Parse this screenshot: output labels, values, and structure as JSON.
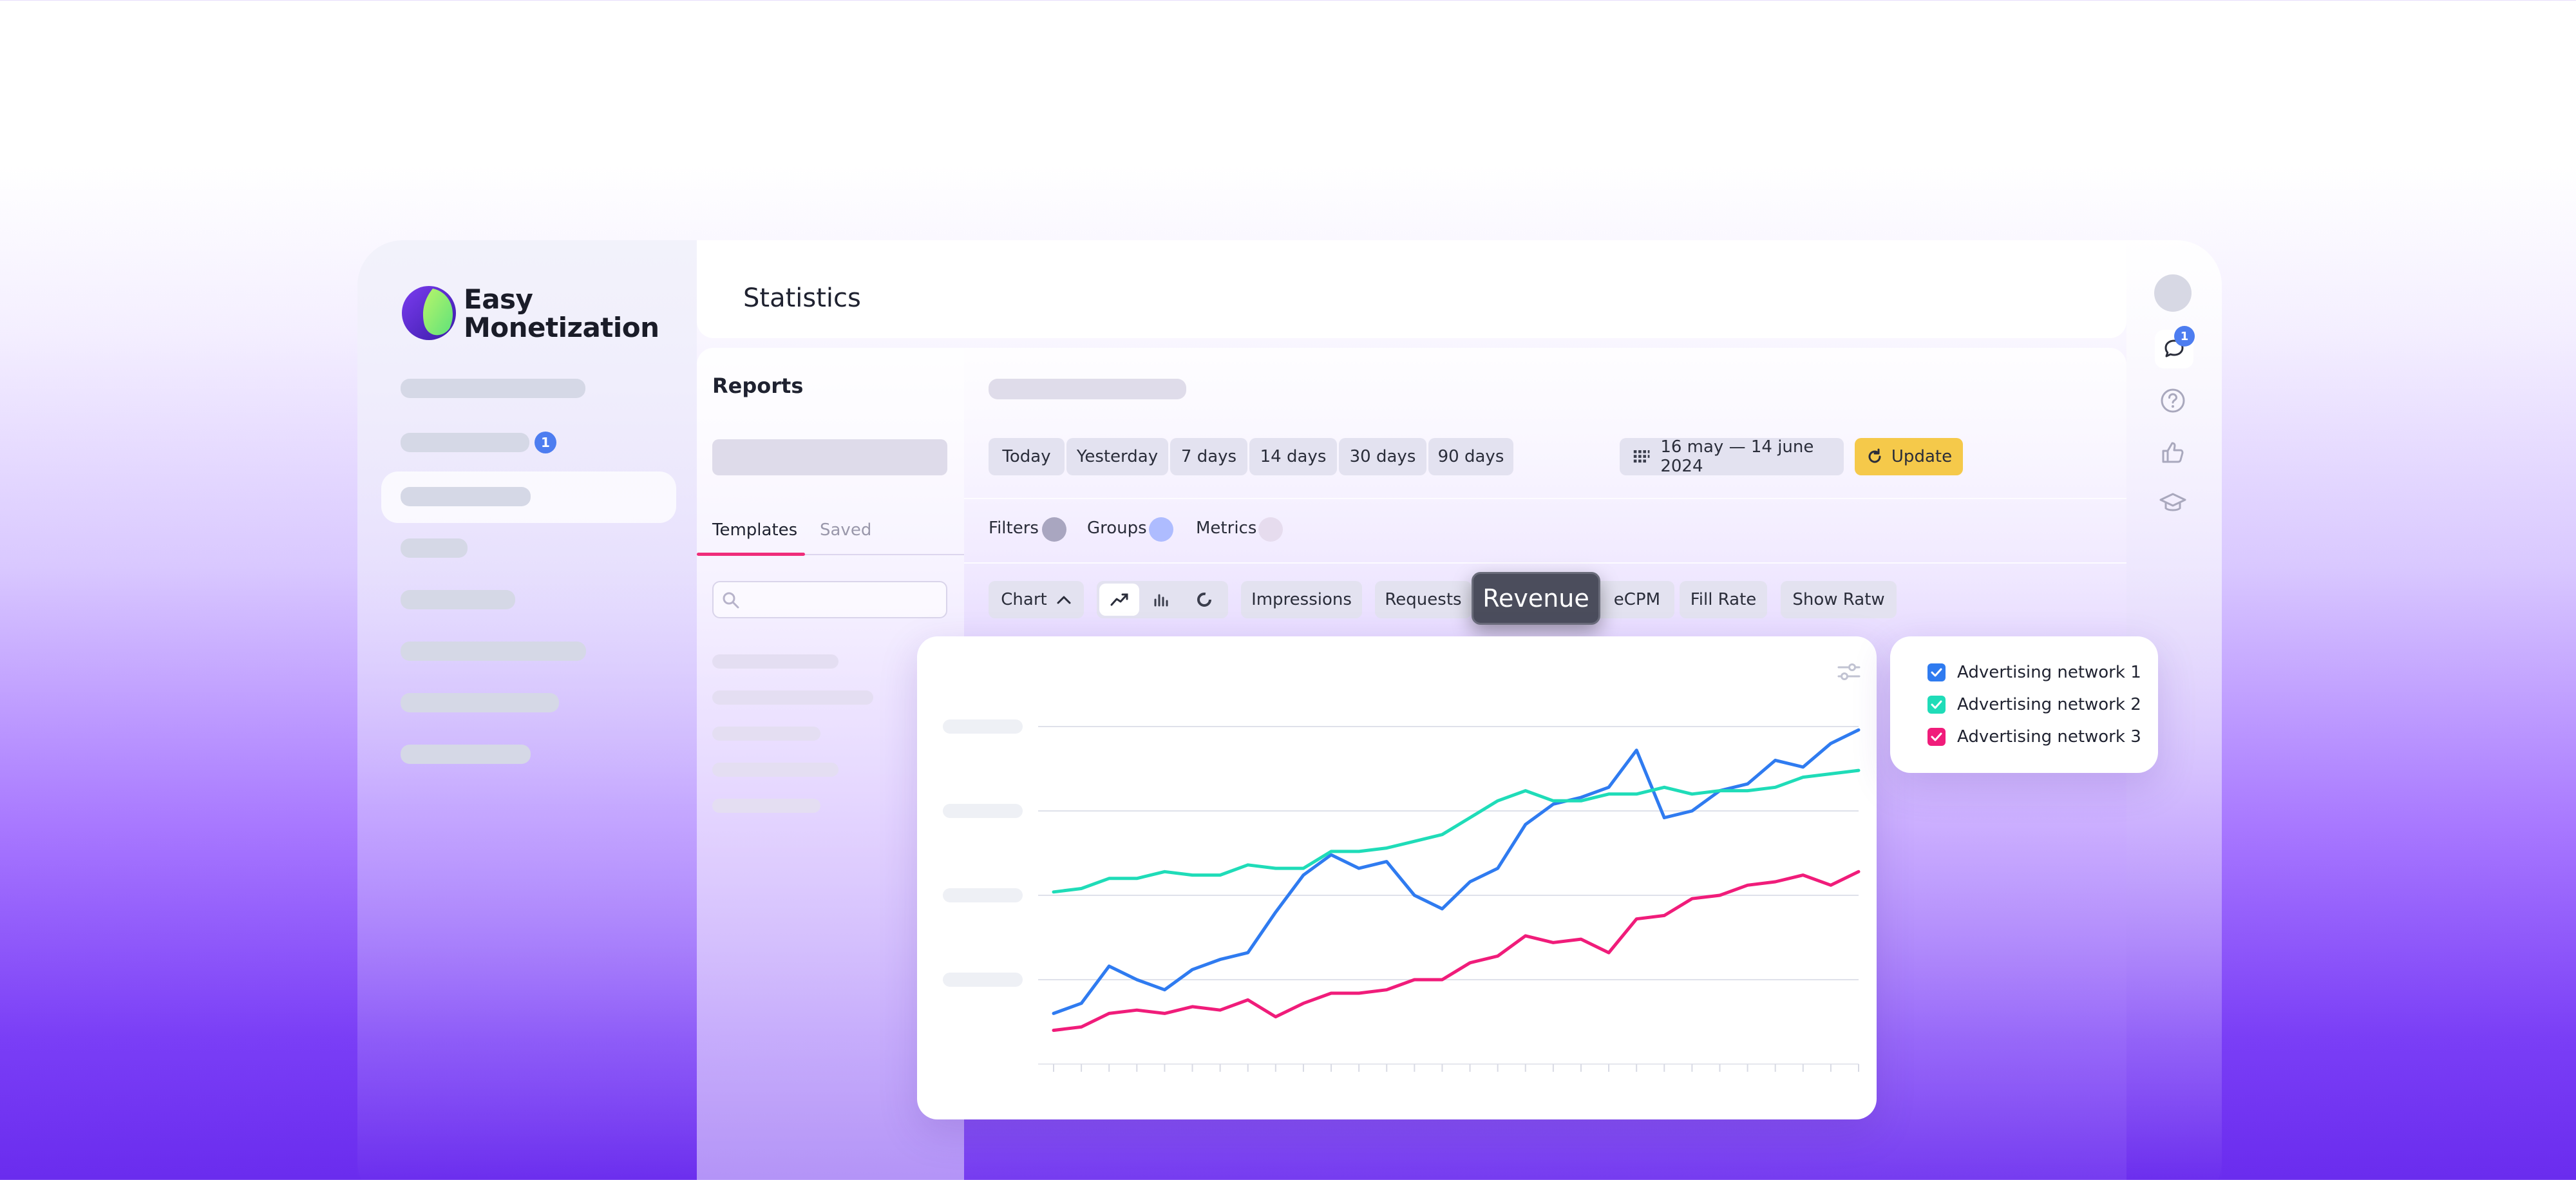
{
  "app": {
    "name_line1": "Easy",
    "name_line2": "Monetization"
  },
  "sidebar": {
    "badge_count": "1"
  },
  "header": {
    "title": "Statistics"
  },
  "reports": {
    "title": "Reports",
    "tabs": [
      {
        "label": "Templates",
        "active": true
      },
      {
        "label": "Saved",
        "active": false
      }
    ]
  },
  "periods": [
    "Today",
    "Yesterday",
    "7 days",
    "14 days",
    "30 days",
    "90 days"
  ],
  "date_range": "16 may — 14 june 2024",
  "update_label": "Update",
  "filters": [
    {
      "label": "Filters",
      "color": "#a9a6c0"
    },
    {
      "label": "Groups",
      "color": "#aebcff"
    },
    {
      "label": "Metrics",
      "color": "#e6dcee"
    }
  ],
  "metrics": {
    "chart_label": "Chart",
    "items": [
      "Impressions",
      "Requests",
      "eCPM",
      "Fill Rate",
      "Show Ratw"
    ],
    "tooltip": "Revenue"
  },
  "right_rail": {
    "messages_badge": "1"
  },
  "icons": [
    "calendar-grid-icon",
    "refresh-icon",
    "chevron-up-icon",
    "line-chart-icon",
    "bar-chart-icon",
    "donut-chart-icon",
    "search-icon",
    "settings-sliders-icon",
    "chat-icon",
    "help-icon",
    "thumbs-up-icon",
    "graduation-cap-icon"
  ],
  "colors": {
    "network1": "#2f7bf0",
    "network2": "#1fdcb8",
    "network3": "#f01c7a",
    "accent_update": "#f5c94a"
  },
  "chart_data": {
    "type": "line",
    "title": "",
    "xlabel": "",
    "ylabel": "",
    "x": [
      1,
      2,
      3,
      4,
      5,
      6,
      7,
      8,
      9,
      10,
      11,
      12,
      13,
      14,
      15,
      16,
      17,
      18,
      19,
      20,
      21,
      22,
      23,
      24,
      25,
      26,
      27,
      28,
      29,
      30
    ],
    "ylim": [
      0,
      100
    ],
    "grid": true,
    "legend": "right-outside",
    "series": [
      {
        "name": "Advertising network 1",
        "color": "#2f7bf0",
        "values": [
          15,
          18,
          29,
          25,
          22,
          28,
          31,
          33,
          45,
          56,
          62,
          58,
          60,
          50,
          46,
          54,
          58,
          71,
          77,
          79,
          82,
          93,
          73,
          75,
          81,
          83,
          90,
          88,
          95,
          99
        ]
      },
      {
        "name": "Advertising network 2",
        "color": "#1fdcb8",
        "values": [
          51,
          52,
          55,
          55,
          57,
          56,
          56,
          59,
          58,
          58,
          63,
          63,
          64,
          66,
          68,
          73,
          78,
          81,
          78,
          78,
          80,
          80,
          82,
          80,
          81,
          81,
          82,
          85,
          86,
          87
        ]
      },
      {
        "name": "Advertising network 3",
        "color": "#f01c7a",
        "values": [
          10,
          11,
          15,
          16,
          15,
          17,
          16,
          19,
          14,
          18,
          21,
          21,
          22,
          25,
          25,
          30,
          32,
          38,
          36,
          37,
          33,
          43,
          44,
          49,
          50,
          53,
          54,
          56,
          53,
          57
        ]
      }
    ]
  }
}
